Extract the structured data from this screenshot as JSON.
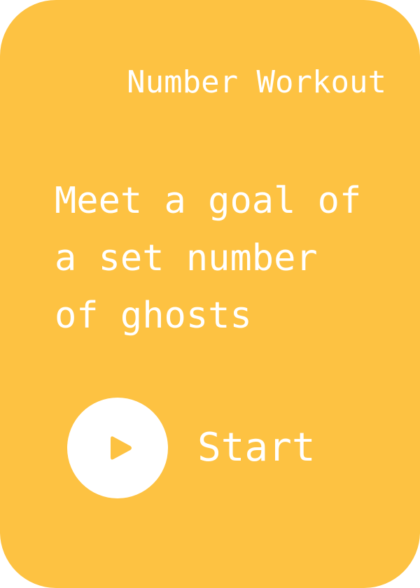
{
  "card": {
    "title": "Number Workout",
    "description": "Meet a goal of a set number of ghosts",
    "background_color": "#fdc242",
    "text_color": "#ffffff"
  },
  "start": {
    "label": "Start",
    "icon": "play-icon",
    "icon_color": "#fdc242"
  }
}
